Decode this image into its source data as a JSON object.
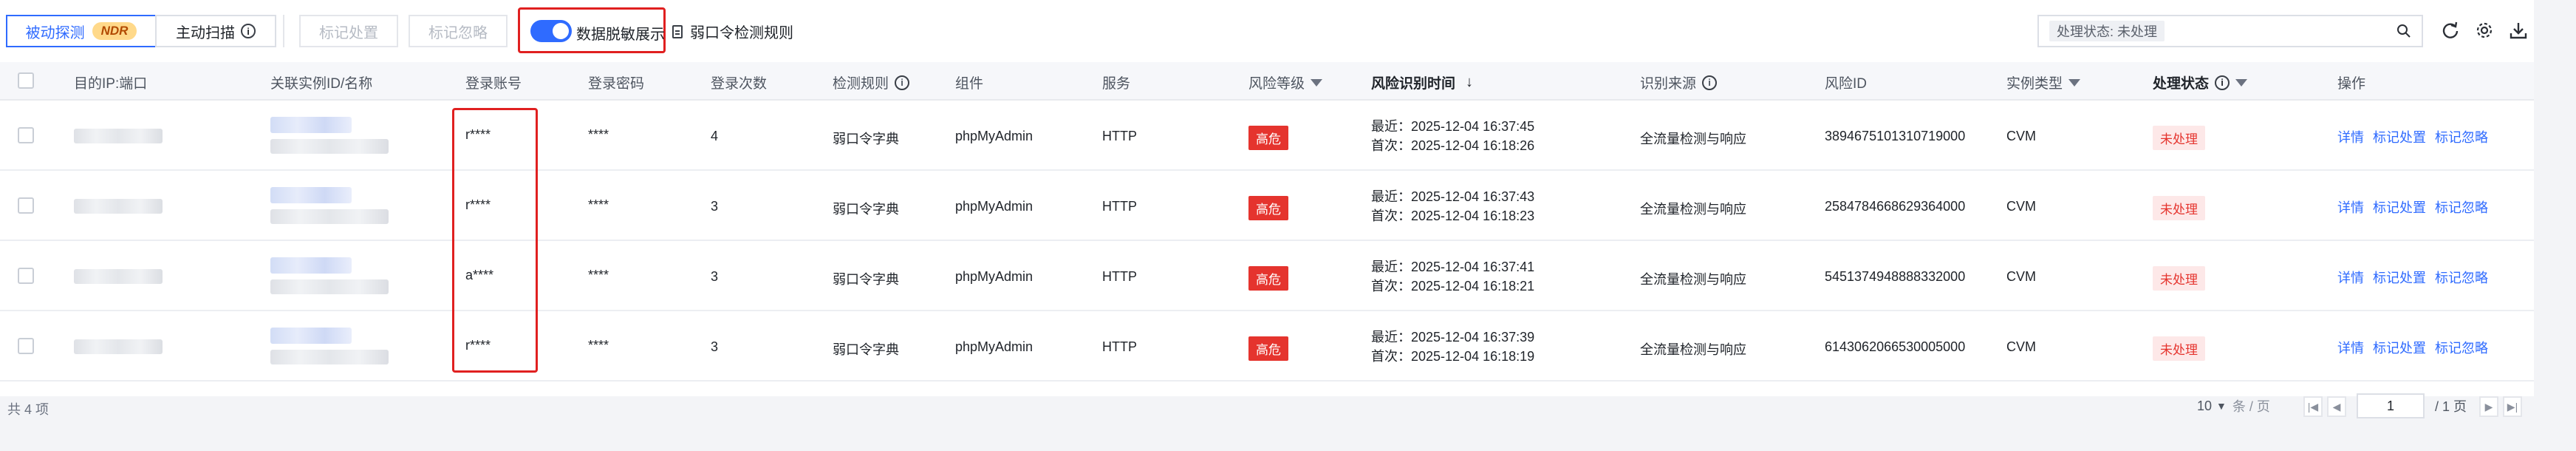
{
  "toolbar": {
    "tab_passive": "被动探测",
    "tab_passive_badge": "NDR",
    "tab_active": "主动扫描",
    "btn_mark_handle": "标记处置",
    "btn_mark_ignore": "标记忽略",
    "toggle_label": "数据脱敏展示",
    "toggle_on": true,
    "rule_link": "弱口令检测规则",
    "filter_tag": "处理状态: 未处理"
  },
  "table": {
    "headers": {
      "target": "目的IP:端口",
      "instance": "关联实例ID/名称",
      "account": "登录账号",
      "password": "登录密码",
      "count": "登录次数",
      "rule": "检测规则",
      "component": "组件",
      "service": "服务",
      "risk_level": "风险等级",
      "time": "风险识别时间",
      "source": "识别来源",
      "risk_id": "风险ID",
      "instance_type": "实例类型",
      "status": "处理状态",
      "action": "操作"
    },
    "rows": [
      {
        "account": "r****",
        "password": "****",
        "count": "4",
        "rule": "弱口令字典",
        "component": "phpMyAdmin",
        "service": "HTTP",
        "risk_level": "高危",
        "latest": "最近：2025-12-04 16:37:45",
        "first": "首次：2025-12-04 16:18:26",
        "source": "全流量检测与响应",
        "risk_id": "3894675101310719000",
        "instance_type": "CVM",
        "status": "未处理",
        "op_detail": "详情",
        "op_handle": "标记处置",
        "op_ignore": "标记忽略"
      },
      {
        "account": "r****",
        "password": "****",
        "count": "3",
        "rule": "弱口令字典",
        "component": "phpMyAdmin",
        "service": "HTTP",
        "risk_level": "高危",
        "latest": "最近：2025-12-04 16:37:43",
        "first": "首次：2025-12-04 16:18:23",
        "source": "全流量检测与响应",
        "risk_id": "2584784668629364000",
        "instance_type": "CVM",
        "status": "未处理",
        "op_detail": "详情",
        "op_handle": "标记处置",
        "op_ignore": "标记忽略"
      },
      {
        "account": "a****",
        "password": "****",
        "count": "3",
        "rule": "弱口令字典",
        "component": "phpMyAdmin",
        "service": "HTTP",
        "risk_level": "高危",
        "latest": "最近：2025-12-04 16:37:41",
        "first": "首次：2025-12-04 16:18:21",
        "source": "全流量检测与响应",
        "risk_id": "5451374948888332000",
        "instance_type": "CVM",
        "status": "未处理",
        "op_detail": "详情",
        "op_handle": "标记处置",
        "op_ignore": "标记忽略"
      },
      {
        "account": "r****",
        "password": "****",
        "count": "3",
        "rule": "弱口令字典",
        "component": "phpMyAdmin",
        "service": "HTTP",
        "risk_level": "高危",
        "latest": "最近：2025-12-04 16:37:39",
        "first": "首次：2025-12-04 16:18:19",
        "source": "全流量检测与响应",
        "risk_id": "6143062066530005000",
        "instance_type": "CVM",
        "status": "未处理",
        "op_detail": "详情",
        "op_handle": "标记处置",
        "op_ignore": "标记忽略"
      }
    ]
  },
  "footer": {
    "total": "共 4 项",
    "page_size": "10",
    "page_size_unit": "条 / 页",
    "page_value": "1",
    "page_total": "/ 1 页"
  },
  "colors": {
    "accent": "#2f6bff",
    "danger": "#e5342e",
    "highlight_box": "#e02020"
  }
}
